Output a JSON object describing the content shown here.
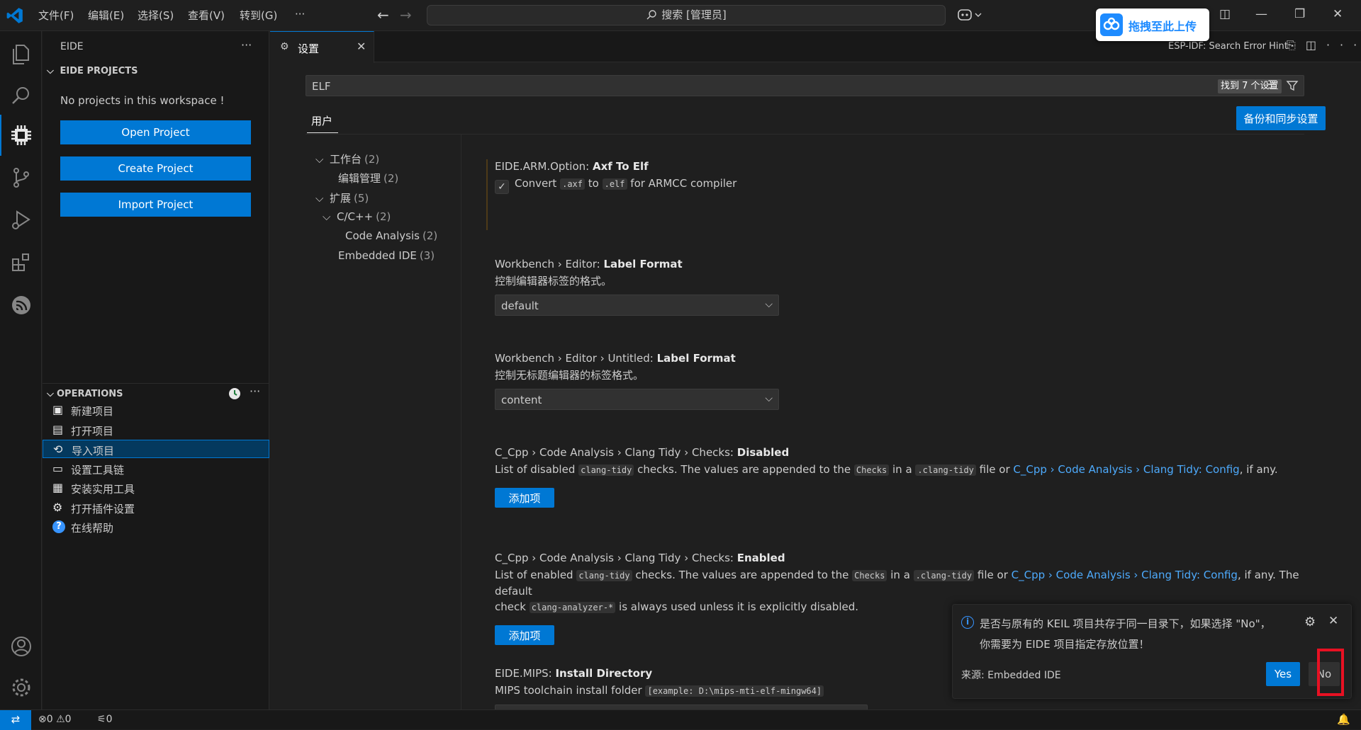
{
  "titlebar": {
    "menus": [
      "文件(F)",
      "编辑(E)",
      "选择(S)",
      "查看(V)",
      "转到(G)",
      "···"
    ],
    "command_center": "搜索 [管理员]",
    "baidu_upload_label": "拖拽至此上传"
  },
  "sidebar": {
    "title": "EIDE",
    "projects_header": "EIDE PROJECTS",
    "no_projects_text": "No projects in this workspace !",
    "buttons": [
      "Open Project",
      "Create Project",
      "Import Project"
    ],
    "operations_header": "OPERATIONS",
    "operations": [
      {
        "label": "新建项目",
        "icon": "new-project-icon"
      },
      {
        "label": "打开项目",
        "icon": "open-project-icon"
      },
      {
        "label": "导入项目",
        "icon": "import-project-icon"
      },
      {
        "label": "设置工具链",
        "icon": "toolchain-icon"
      },
      {
        "label": "安装实用工具",
        "icon": "install-tools-icon"
      },
      {
        "label": "打开插件设置",
        "icon": "gear-icon"
      },
      {
        "label": "在线帮助",
        "icon": "help-icon"
      }
    ],
    "selected_operation": 2
  },
  "editor": {
    "tab_label": "设置",
    "right_label": "ESP-IDF: Search Error Hint",
    "search_value": "ELF",
    "search_count": "找到 7 个设置",
    "scope_tab": "用户",
    "sync_button": "备份和同步设置",
    "toc": [
      {
        "label": "工作台",
        "count": "(2)",
        "level": 0,
        "expanded": true
      },
      {
        "label": "编辑管理",
        "count": "(2)",
        "level": 1
      },
      {
        "label": "扩展",
        "count": "(5)",
        "level": 0,
        "expanded": true
      },
      {
        "label": "C/C++",
        "count": "(2)",
        "level": 1,
        "expanded": true
      },
      {
        "label": "Code Analysis",
        "count": "(2)",
        "level": 2
      },
      {
        "label": "Embedded IDE",
        "count": "(3)",
        "level": 1
      }
    ],
    "settings": {
      "axf": {
        "prefix": "EIDE.ARM.Option: ",
        "name": "Axf To Elf",
        "checked": true,
        "desc_before": "Convert ",
        "code1": ".axf",
        "desc_mid": " to ",
        "code2": ".elf",
        "desc_after": " for ARMCC compiler"
      },
      "label_format": {
        "prefix": "Workbench › Editor: ",
        "name": "Label Format",
        "desc": "控制编辑器标签的格式。",
        "value": "default"
      },
      "untitled_format": {
        "prefix": "Workbench › Editor › Untitled: ",
        "name": "Label Format",
        "desc": "控制无标题编辑器的标签格式。",
        "value": "content"
      },
      "checks_disabled": {
        "prefix": "C_Cpp › Code Analysis › Clang Tidy › Checks: ",
        "name": "Disabled",
        "d1": "List of disabled ",
        "c1": "clang-tidy",
        "d2": " checks. The values are appended to the ",
        "c2": "Checks",
        "d3": " in a ",
        "c3": ".clang-tidy",
        "d4": " file or ",
        "link": "C_Cpp › Code Analysis › Clang Tidy: Config",
        "d5": ", if any.",
        "button": "添加项"
      },
      "checks_enabled": {
        "prefix": "C_Cpp › Code Analysis › Clang Tidy › Checks: ",
        "name": "Enabled",
        "d1": "List of enabled ",
        "c1": "clang-tidy",
        "d2": " checks. The values are appended to the ",
        "c2": "Checks",
        "d3": " in a ",
        "c3": ".clang-tidy",
        "d4": " file or ",
        "link": "C_Cpp › Code Analysis › Clang Tidy: Config",
        "d5": ", if any. The default",
        "d6": "check ",
        "c4": "clang-analyzer-*",
        "d7": " is always used unless it is explicitly disabled.",
        "button": "添加项"
      },
      "mips": {
        "prefix": "EIDE.MIPS: ",
        "name": "Install Directory",
        "desc": "MIPS toolchain install folder ",
        "code": "[example: D:\\mips-mti-elf-mingw64]",
        "value": ""
      }
    }
  },
  "notification": {
    "line1": "是否与原有的 KEIL 项目共存于同一目录下，如果选择 \"No\"，",
    "line2": "你需要为 EIDE 项目指定存放位置！",
    "source": "来源: Embedded IDE",
    "yes": "Yes",
    "no": "No"
  },
  "statusbar": {
    "errors": "0",
    "warnings": "0",
    "ports": "0"
  },
  "colors": {
    "accent": "#0078d4",
    "highlight": "#e81123",
    "link": "#4daafc"
  }
}
